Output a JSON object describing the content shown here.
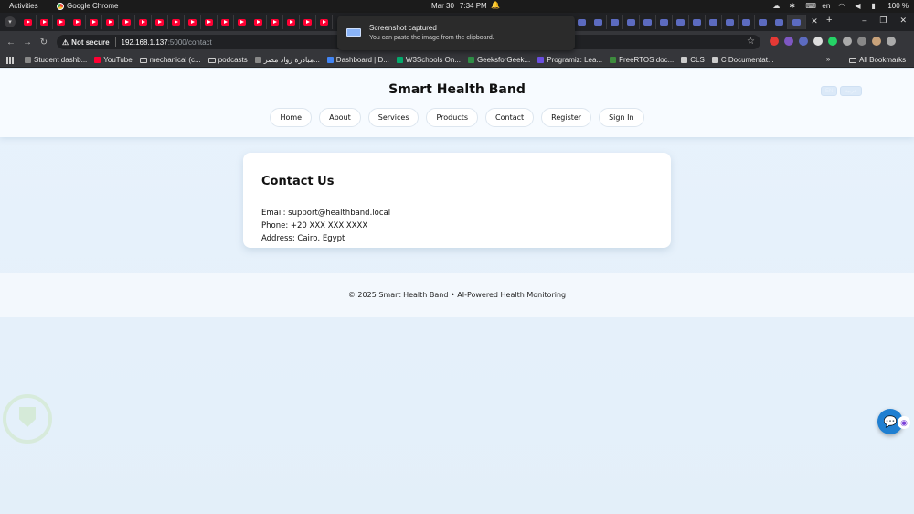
{
  "os": {
    "activities": "Activities",
    "app_name": "Google Chrome",
    "date": "Mar 30",
    "time": "7:34 PM",
    "language": "en",
    "battery": "100 %"
  },
  "notification": {
    "title": "Screenshot captured",
    "body": "You can paste the image from the clipboard."
  },
  "browser": {
    "not_secure": "Not secure",
    "url_host": "192.168.1.137",
    "url_path": ":5000/contact"
  },
  "bookmarks": [
    {
      "label": "Student dashb..."
    },
    {
      "label": "YouTube"
    },
    {
      "label": "mechanical (c..."
    },
    {
      "label": "podcasts"
    },
    {
      "label": "مبادرة رواد مصر..."
    },
    {
      "label": "Dashboard | D..."
    },
    {
      "label": "W3Schools On..."
    },
    {
      "label": "GeeksforGeek..."
    },
    {
      "label": "Programiz: Lea..."
    },
    {
      "label": "FreeRTOS doc..."
    },
    {
      "label": "CLS"
    },
    {
      "label": "C Documentat..."
    }
  ],
  "bookmarks_more": "»",
  "all_bookmarks": "All Bookmarks",
  "site": {
    "brand": "Smart Health Band",
    "lang_en": "EN",
    "lang_ar": "عربية",
    "nav": [
      "Home",
      "About",
      "Services",
      "Products",
      "Contact",
      "Register",
      "Sign In"
    ]
  },
  "contact": {
    "title": "Contact Us",
    "email": "Email: support@healthband.local",
    "phone": "Phone: +20 XXX XXX XXXX",
    "address": "Address: Cairo, Egypt"
  },
  "footer": {
    "text": "© 2025 Smart Health Band • AI-Powered Health Monitoring"
  }
}
